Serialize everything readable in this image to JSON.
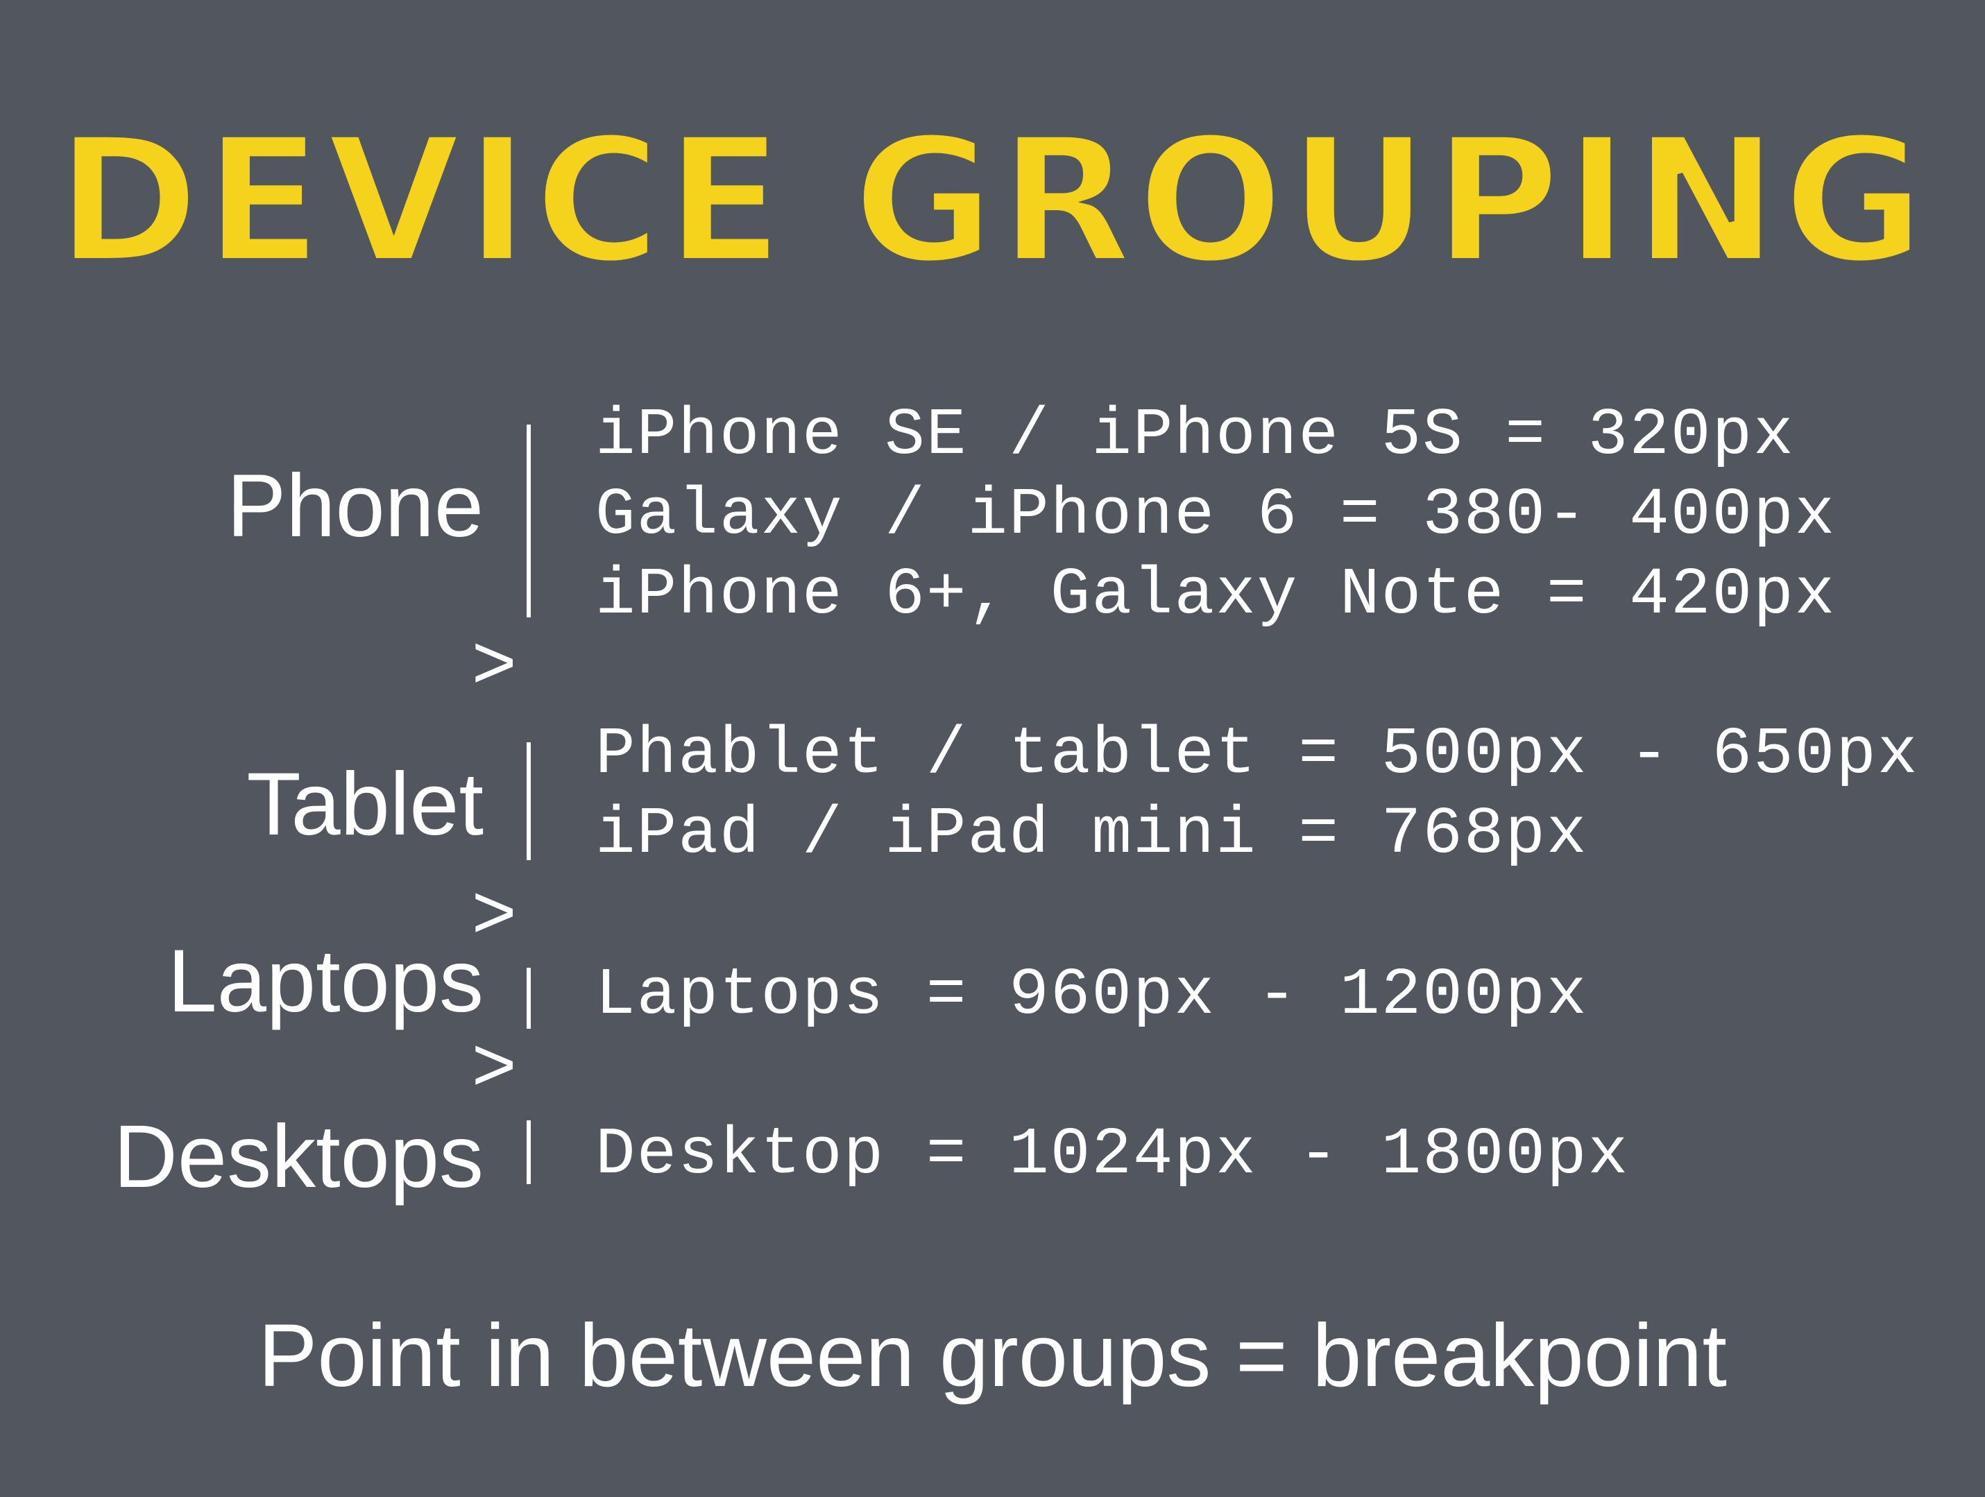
{
  "title": "DEVICE GROUPING",
  "colors": {
    "background": "#52565f",
    "title": "#f5d21b",
    "text": "#ffffff"
  },
  "groups": [
    {
      "label": "Phone",
      "specs": [
        "iPhone SE / iPhone 5S = 320px",
        "Galaxy / iPhone 6 = 380- 400px",
        "iPhone 6+, Galaxy Note = 420px"
      ]
    },
    {
      "label": "Tablet",
      "specs": [
        "Phablet / tablet = 500px - 650px",
        "iPad / iPad mini = 768px"
      ]
    },
    {
      "label": "Laptops",
      "specs": [
        "Laptops = 960px - 1200px"
      ]
    },
    {
      "label": "Desktops",
      "specs": [
        "Desktop = 1024px - 1800px"
      ]
    }
  ],
  "separator": ">",
  "footer": "Point in between groups = breakpoint"
}
